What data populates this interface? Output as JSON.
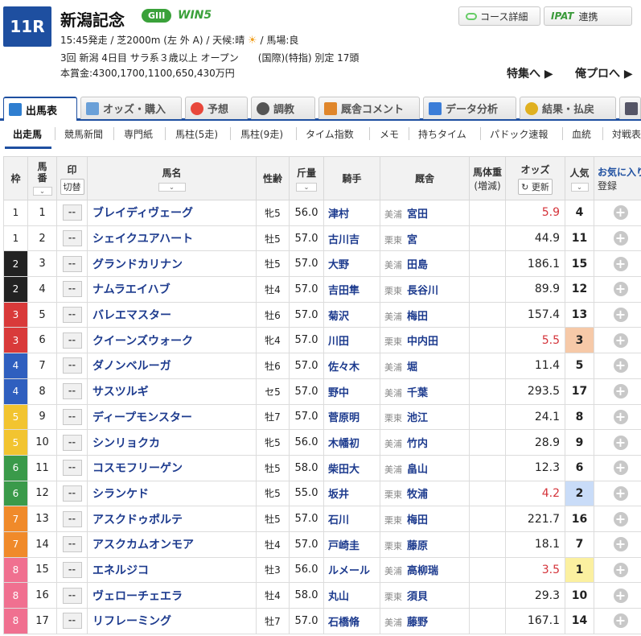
{
  "race": {
    "number": "11R",
    "title": "新潟記念",
    "grade": "GIII",
    "win5": "WIN5",
    "line1": "15:45発走 / 芝2000m (左 外 A) / 天候:晴",
    "weather_icon": "sun-icon",
    "baba": " / 馬場:良",
    "line2": "3回 新潟 4日目 サラ系３歳以上 オープン　　(国際)(特指) 別定 17頭",
    "line3": "本賞金:4300,1700,1100,650,430万円"
  },
  "header_buttons": {
    "course": "コース詳細",
    "ipat_logo": "IPAT",
    "ipat": "連携"
  },
  "feature_links": [
    "特集へ ▶",
    "俺プロへ ▶"
  ],
  "tabs": [
    "出馬表",
    "オッズ・購入",
    "予想",
    "調教",
    "厩舎コメント",
    "データ分析",
    "結果・払戻"
  ],
  "subnav": [
    "出走馬",
    "競馬新聞",
    "専門紙",
    "馬柱(5走)",
    "馬柱(9走)",
    "タイム指数",
    "メモ",
    "持ちタイム",
    "パドック速報",
    "血統",
    "対戦表"
  ],
  "columns": {
    "waku": "枠",
    "umaban": "馬番",
    "mark": "印",
    "mark_btn": "切替",
    "name": "馬名",
    "sex": "性齢",
    "kinryo": "斤量",
    "jockey": "騎手",
    "stable": "厩舎",
    "weight": "馬体重",
    "weight_sub": "(増減)",
    "odds": "オッズ",
    "update": "更新",
    "ninki": "人気",
    "fav": "お気に入り",
    "fav_btn": "登録"
  },
  "waku_colors": {
    "1": [
      "#ffffff",
      "#222222"
    ],
    "2": [
      "#222222",
      "#ffffff"
    ],
    "3": [
      "#d93a3a",
      "#ffffff"
    ],
    "4": [
      "#2f5fbf",
      "#ffffff"
    ],
    "5": [
      "#f2c430",
      "#ffffff"
    ],
    "6": [
      "#3a9a4a",
      "#ffffff"
    ],
    "7": [
      "#f08a2a",
      "#ffffff"
    ],
    "8": [
      "#f07090",
      "#ffffff"
    ]
  },
  "horses": [
    {
      "waku": "1",
      "umaban": "1",
      "mark": "--",
      "name": "ブレイディヴェーグ",
      "sex": "牝5",
      "kin": "56.0",
      "jockey": "津村",
      "belong": "美浦",
      "trainer": "宮田",
      "odds": "5.9",
      "red": true,
      "ninki": "4",
      "hl": ""
    },
    {
      "waku": "1",
      "umaban": "2",
      "mark": "--",
      "name": "シェイクユアハート",
      "sex": "牡5",
      "kin": "57.0",
      "jockey": "古川吉",
      "belong": "栗東",
      "trainer": "宮",
      "odds": "44.9",
      "red": false,
      "ninki": "11",
      "hl": ""
    },
    {
      "waku": "2",
      "umaban": "3",
      "mark": "--",
      "name": "グランドカリナン",
      "sex": "牡5",
      "kin": "57.0",
      "jockey": "大野",
      "belong": "美浦",
      "trainer": "田島",
      "odds": "186.1",
      "red": false,
      "ninki": "15",
      "hl": ""
    },
    {
      "waku": "2",
      "umaban": "4",
      "mark": "--",
      "name": "ナムラエイハブ",
      "sex": "牡4",
      "kin": "57.0",
      "jockey": "吉田隼",
      "belong": "栗東",
      "trainer": "長谷川",
      "odds": "89.9",
      "red": false,
      "ninki": "12",
      "hl": ""
    },
    {
      "waku": "3",
      "umaban": "5",
      "mark": "--",
      "name": "バレエマスター",
      "sex": "牡6",
      "kin": "57.0",
      "jockey": "菊沢",
      "belong": "美浦",
      "trainer": "梅田",
      "odds": "157.4",
      "red": false,
      "ninki": "13",
      "hl": ""
    },
    {
      "waku": "3",
      "umaban": "6",
      "mark": "--",
      "name": "クイーンズウォーク",
      "sex": "牝4",
      "kin": "57.0",
      "jockey": "川田",
      "belong": "栗東",
      "trainer": "中内田",
      "odds": "5.5",
      "red": true,
      "ninki": "3",
      "hl": "#f6c9a8"
    },
    {
      "waku": "4",
      "umaban": "7",
      "mark": "--",
      "name": "ダノンベルーガ",
      "sex": "牡6",
      "kin": "57.0",
      "jockey": "佐々木",
      "belong": "美浦",
      "trainer": "堀",
      "odds": "11.4",
      "red": false,
      "ninki": "5",
      "hl": ""
    },
    {
      "waku": "4",
      "umaban": "8",
      "mark": "--",
      "name": "サスツルギ",
      "sex": "セ5",
      "kin": "57.0",
      "jockey": "野中",
      "belong": "美浦",
      "trainer": "千葉",
      "odds": "293.5",
      "red": false,
      "ninki": "17",
      "hl": ""
    },
    {
      "waku": "5",
      "umaban": "9",
      "mark": "--",
      "name": "ディープモンスター",
      "sex": "牡7",
      "kin": "57.0",
      "jockey": "菅原明",
      "belong": "栗東",
      "trainer": "池江",
      "odds": "24.1",
      "red": false,
      "ninki": "8",
      "hl": ""
    },
    {
      "waku": "5",
      "umaban": "10",
      "mark": "--",
      "name": "シンリョクカ",
      "sex": "牝5",
      "kin": "56.0",
      "jockey": "木幡初",
      "belong": "美浦",
      "trainer": "竹内",
      "odds": "28.9",
      "red": false,
      "ninki": "9",
      "hl": ""
    },
    {
      "waku": "6",
      "umaban": "11",
      "mark": "--",
      "name": "コスモフリーゲン",
      "sex": "牡5",
      "kin": "58.0",
      "jockey": "柴田大",
      "belong": "美浦",
      "trainer": "畠山",
      "odds": "12.3",
      "red": false,
      "ninki": "6",
      "hl": ""
    },
    {
      "waku": "6",
      "umaban": "12",
      "mark": "--",
      "name": "シランケド",
      "sex": "牝5",
      "kin": "55.0",
      "jockey": "坂井",
      "belong": "栗東",
      "trainer": "牧浦",
      "odds": "4.2",
      "red": true,
      "ninki": "2",
      "hl": "#c9dcf8"
    },
    {
      "waku": "7",
      "umaban": "13",
      "mark": "--",
      "name": "アスクドゥポルテ",
      "sex": "牡5",
      "kin": "57.0",
      "jockey": "石川",
      "belong": "栗東",
      "trainer": "梅田",
      "odds": "221.7",
      "red": false,
      "ninki": "16",
      "hl": ""
    },
    {
      "waku": "7",
      "umaban": "14",
      "mark": "--",
      "name": "アスクカムオンモア",
      "sex": "牡4",
      "kin": "57.0",
      "jockey": "戸崎圭",
      "belong": "栗東",
      "trainer": "藤原",
      "odds": "18.1",
      "red": false,
      "ninki": "7",
      "hl": ""
    },
    {
      "waku": "8",
      "umaban": "15",
      "mark": "--",
      "name": "エネルジコ",
      "sex": "牡3",
      "kin": "56.0",
      "jockey": "ルメール",
      "belong": "美浦",
      "trainer": "高柳瑞",
      "odds": "3.5",
      "red": true,
      "ninki": "1",
      "hl": "#fbf0a0"
    },
    {
      "waku": "8",
      "umaban": "16",
      "mark": "--",
      "name": "ヴェローチェエラ",
      "sex": "牡4",
      "kin": "58.0",
      "jockey": "丸山",
      "belong": "栗東",
      "trainer": "須貝",
      "odds": "29.3",
      "red": false,
      "ninki": "10",
      "hl": ""
    },
    {
      "waku": "8",
      "umaban": "17",
      "mark": "--",
      "name": "リフレーミング",
      "sex": "牡7",
      "kin": "57.0",
      "jockey": "石橋脩",
      "belong": "美浦",
      "trainer": "藤野",
      "odds": "167.1",
      "red": false,
      "ninki": "14",
      "hl": ""
    }
  ]
}
